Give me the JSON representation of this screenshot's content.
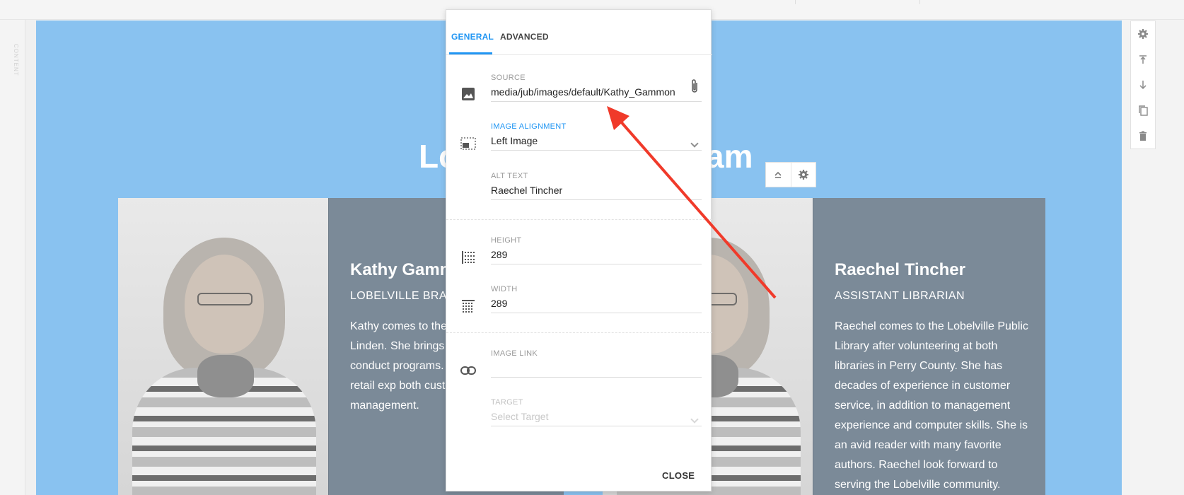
{
  "gutter": {
    "label": "CONTENT"
  },
  "page": {
    "title_left": "Lo",
    "title_right": "am"
  },
  "cards": [
    {
      "name": "Kathy Gamm",
      "role": "LOBELVILLE BRANC",
      "bio": "Kathy comes to the Library after workin Linden. She brings r experience conduct programs. In additio decade of retail exp both customer serv management."
    },
    {
      "name": "Raechel Tincher",
      "role": "ASSISTANT  LIBRARIAN",
      "bio": "Raechel comes to the Lobelville Public Library after volunteering at both libraries in Perry County.  She has decades of experience in customer service, in addition to management experience and computer skills.  She is an avid reader with many favorite authors.  Raechel look forward to serving the Lobelville community."
    }
  ],
  "modal": {
    "tabs": [
      "GENERAL",
      "ADVANCED"
    ],
    "source": {
      "label": "SOURCE",
      "value": "media/jub/images/default/Kathy_Gammon"
    },
    "alignment": {
      "label": "IMAGE ALIGNMENT",
      "value": "Left Image"
    },
    "alt": {
      "label": "ALT TEXT",
      "value": "Raechel Tincher"
    },
    "height": {
      "label": "HEIGHT",
      "value": "289"
    },
    "width": {
      "label": "WIDTH",
      "value": "289"
    },
    "link": {
      "label": "IMAGE LINK",
      "value": ""
    },
    "target": {
      "label": "TARGET",
      "placeholder": "Select Target"
    },
    "close_label": "CLOSE"
  },
  "colors": {
    "accent": "#2196f3",
    "section_bg": "#89c2f0",
    "card_bg": "#7b8a98",
    "annotation": "#f03a2a"
  },
  "icons": [
    "image-icon",
    "image-alignment-icon",
    "height-icon",
    "width-icon",
    "link-icon",
    "paperclip-icon",
    "gear-icon",
    "move-top-icon",
    "move-down-icon",
    "copy-icon",
    "trash-icon",
    "collapse-icon"
  ]
}
